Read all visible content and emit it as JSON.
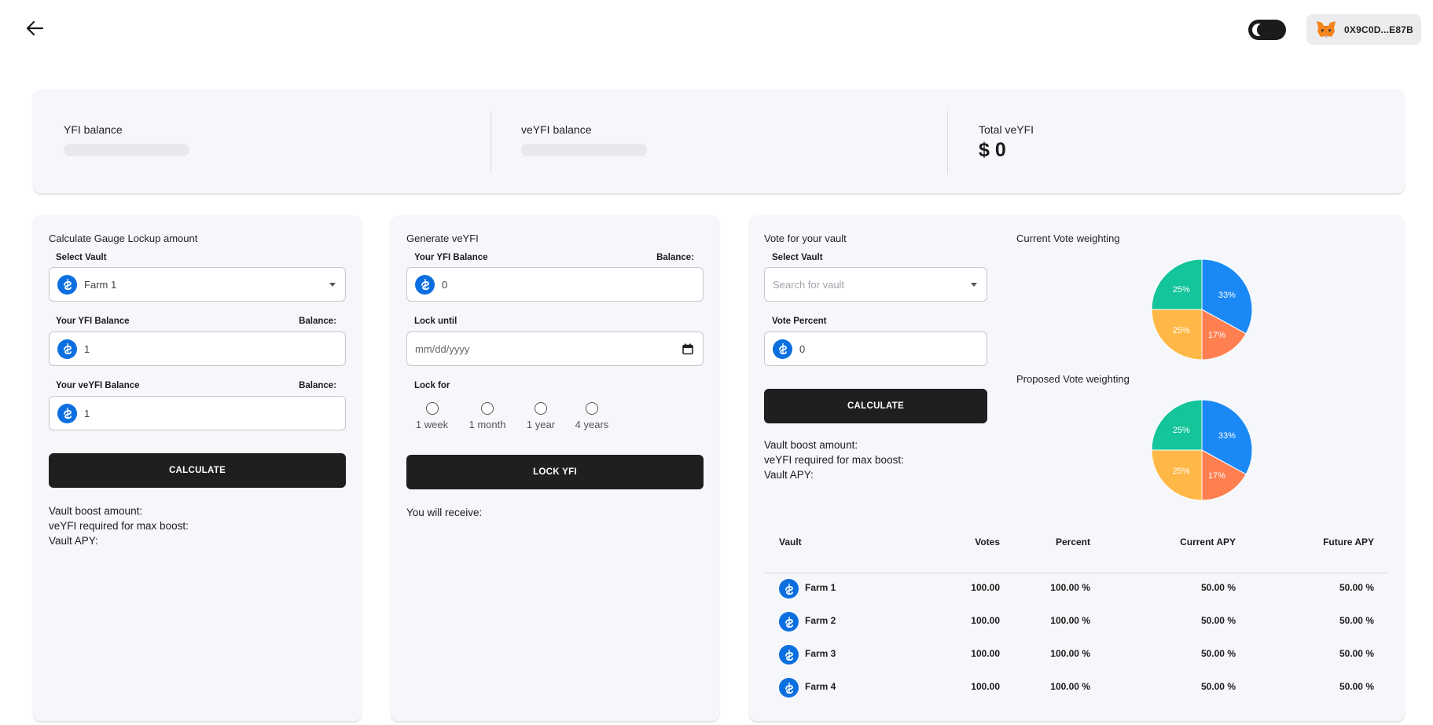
{
  "header": {
    "wallet_address": "0X9C0D...E87B"
  },
  "balances": {
    "yfi_label": "YFI balance",
    "veyfi_label": "veYFI balance",
    "total_label": "Total veYFI",
    "total_value": "$ 0"
  },
  "gauge_card": {
    "title": "Calculate Gauge Lockup amount",
    "select_vault_label": "Select Vault",
    "select_vault_value": "Farm 1",
    "yfi_balance_label": "Your YFI Balance",
    "yfi_balance_right": "Balance:",
    "yfi_balance_value": "1",
    "veyfi_balance_label": "Your veYFI Balance",
    "veyfi_balance_right": "Balance:",
    "veyfi_balance_value": "1",
    "button": "CALCULATE",
    "result_boost": "Vault boost amount:",
    "result_required": "veYFI required for max boost:",
    "result_apy": "Vault APY:"
  },
  "generate_card": {
    "title": "Generate veYFI",
    "yfi_balance_label": "Your YFI Balance",
    "yfi_balance_right": "Balance:",
    "yfi_balance_value": "0",
    "lock_until_label": "Lock until",
    "lock_until_placeholder": "mm/dd/yyyy",
    "lock_for_label": "Lock for",
    "lock_options": [
      "1 week",
      "1 month",
      "1 year",
      "4 years"
    ],
    "button": "LOCK YFI",
    "receive_text": "You will receive:"
  },
  "vote_card": {
    "title": "Vote for your vault",
    "select_vault_label": "Select Vault",
    "select_vault_placeholder": "Search for vault",
    "vote_percent_label": "Vote Percent",
    "vote_percent_value": "0",
    "button": "CALCULATE",
    "result_boost": "Vault boost amount:",
    "result_required": "veYFI required for max boost:",
    "result_apy": "Vault APY:",
    "current_weighting_title": "Current Vote weighting",
    "proposed_weighting_title": "Proposed Vote weighting",
    "pie_slices": [
      {
        "label": "33%",
        "value": 33,
        "color": "#1a88f5"
      },
      {
        "label": "17%",
        "value": 17,
        "color": "#ff7f50"
      },
      {
        "label": "25%",
        "value": 25,
        "color": "#ffb847"
      },
      {
        "label": "25%",
        "value": 25,
        "color": "#14c49a"
      }
    ],
    "table": {
      "headers": [
        "Vault",
        "Votes",
        "Percent",
        "Current APY",
        "Future APY"
      ],
      "rows": [
        [
          "Farm 1",
          "100.00",
          "100.00 %",
          "50.00 %",
          "50.00 %"
        ],
        [
          "Farm 2",
          "100.00",
          "100.00 %",
          "50.00 %",
          "50.00 %"
        ],
        [
          "Farm 3",
          "100.00",
          "100.00 %",
          "50.00 %",
          "50.00 %"
        ],
        [
          "Farm 4",
          "100.00",
          "100.00 %",
          "50.00 %",
          "50.00 %"
        ]
      ]
    }
  }
}
